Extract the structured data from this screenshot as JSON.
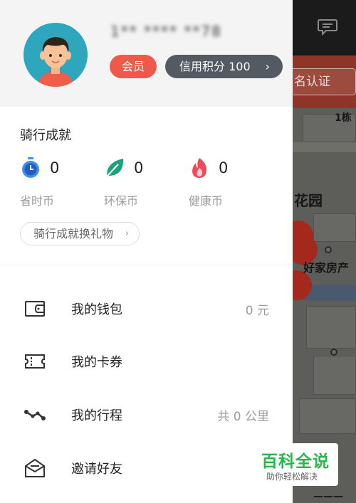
{
  "background_map": {
    "verify_button_label": "名认证",
    "building_label": "1栋",
    "place_label_1": "花园",
    "place_label_2": "好家房产",
    "bottom_label": "———"
  },
  "profile": {
    "phone_masked": "1** **** **78",
    "vip_badge": "会员",
    "credit_label": "信用积分 100",
    "credit_chevron": "›"
  },
  "achievements": {
    "title": "骑行成就",
    "items": [
      {
        "icon": "clock-icon",
        "value": "0",
        "label": "省时币",
        "color": "#3f8ef2"
      },
      {
        "icon": "leaf-icon",
        "value": "0",
        "label": "环保币",
        "color": "#1aa37a"
      },
      {
        "icon": "flame-icon",
        "value": "0",
        "label": "健康币",
        "color": "#f04a5a"
      }
    ],
    "gift_button": "骑行成就换礼物",
    "gift_chevron": "›"
  },
  "menu": [
    {
      "icon": "wallet-icon",
      "label": "我的钱包",
      "value": "0 元"
    },
    {
      "icon": "coupon-icon",
      "label": "我的卡券",
      "value": ""
    },
    {
      "icon": "route-icon",
      "label": "我的行程",
      "value": "共 0 公里"
    },
    {
      "icon": "invite-icon",
      "label": "邀请好友",
      "value": ""
    }
  ],
  "watermark": {
    "title": "百科全说",
    "subtitle": "助你轻松解决"
  },
  "colors": {
    "accent_red": "#f0594a",
    "credit_gray": "#535a62",
    "header_bg": "#f4f4f4",
    "watermark_green": "#2ab54a"
  }
}
